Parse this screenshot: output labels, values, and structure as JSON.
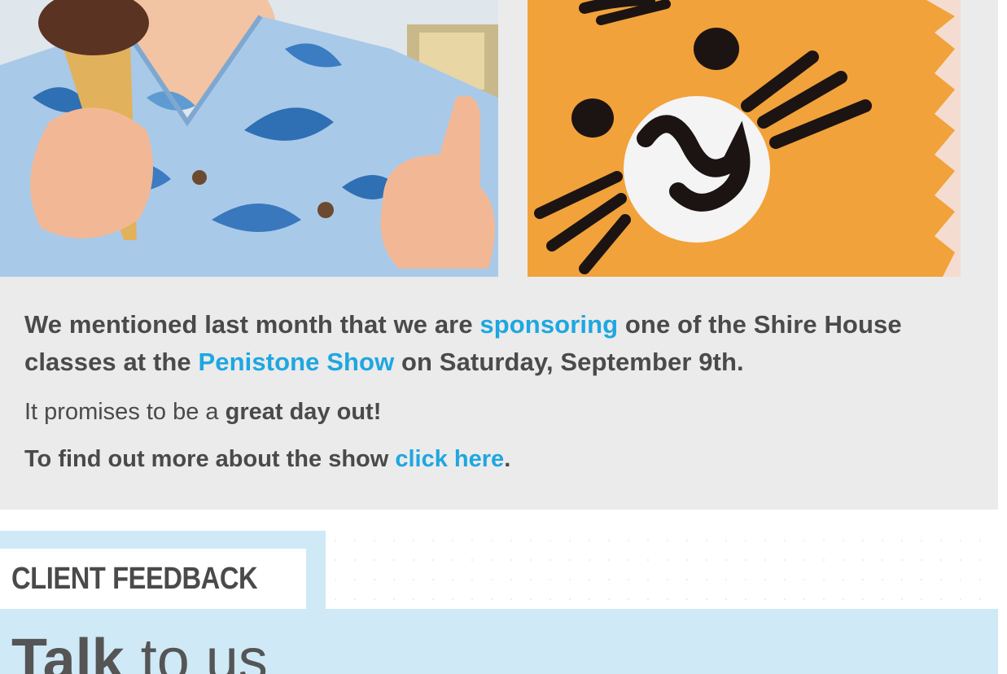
{
  "news": {
    "lead_part1": "We mentioned last month that we are ",
    "lead_link1": "sponsoring",
    "lead_part2": " one of the Shire House classes at the ",
    "lead_link2": "Penistone Show",
    "lead_part3": " on Saturday, September 9th.",
    "promise_part1": "It promises to be a ",
    "promise_bold": "great day out!",
    "more_part1": "To find out more about the show ",
    "more_link": "click here",
    "more_part2": "."
  },
  "feedback": {
    "heading": "CLIENT FEEDBACK",
    "title_bold": "Talk",
    "title_light": " to us"
  },
  "colors": {
    "link": "#1ea7e1",
    "panel": "#ebebeb",
    "band": "#cfe9f6",
    "text": "#4a4a4a"
  },
  "images": {
    "left": "boy-with-ice-cream-thumbs-up",
    "right": "tiger-face-cake"
  }
}
